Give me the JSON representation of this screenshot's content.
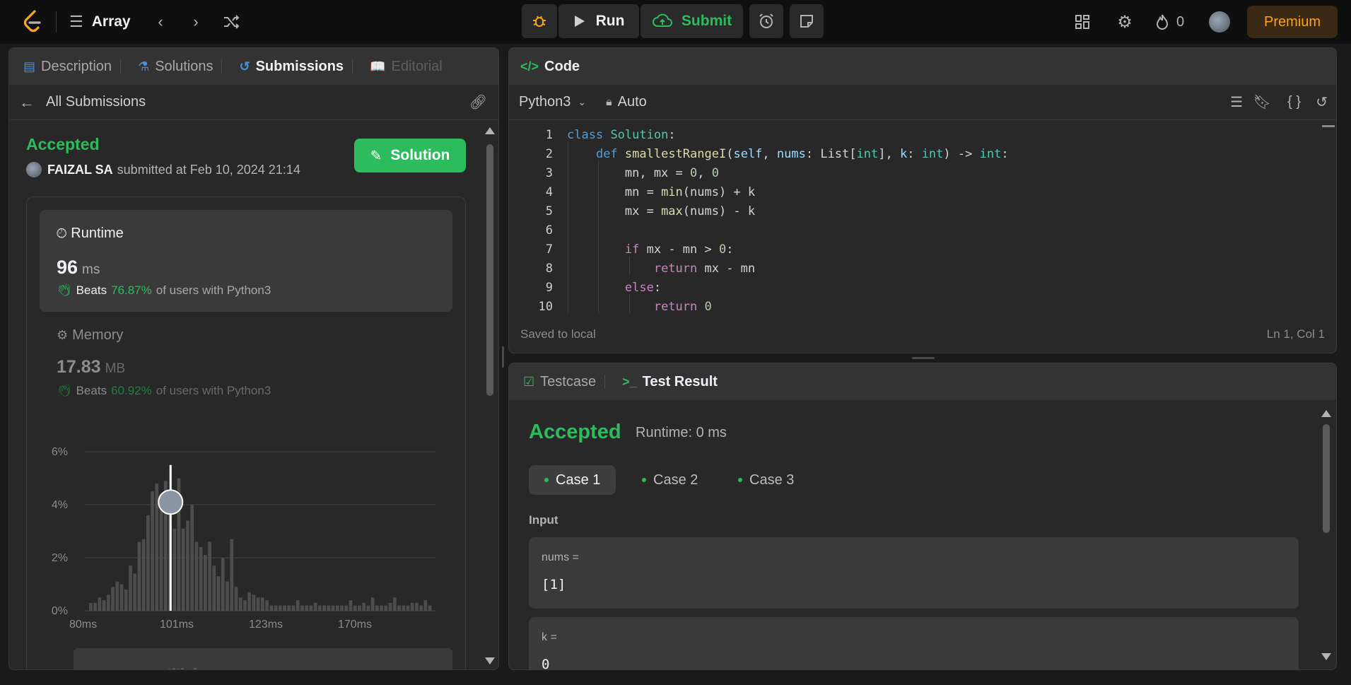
{
  "topbar": {
    "problem_list_label": "Array",
    "run_label": "Run",
    "submit_label": "Submit",
    "streak_count": "0",
    "premium_label": "Premium"
  },
  "left_panel": {
    "tabs": [
      {
        "label": "Description"
      },
      {
        "label": "Solutions"
      },
      {
        "label": "Submissions"
      },
      {
        "label": "Editorial"
      }
    ],
    "all_submissions_label": "All Submissions",
    "status": "Accepted",
    "user_name": "FAIZAL SA",
    "submitted_text": "submitted at Feb 10, 2024 21:14",
    "solution_button": "Solution",
    "runtime": {
      "title": "Runtime",
      "value": "96",
      "unit": "ms",
      "beats_label": "Beats",
      "beats_pct": "76.87%",
      "beats_suffix": "of users with Python3"
    },
    "memory": {
      "title": "Memory",
      "value": "17.83",
      "unit": "MB",
      "beats_label": "Beats",
      "beats_pct": "60.92%",
      "beats_suffix": "of users with Python3"
    }
  },
  "chart_data": {
    "type": "bar",
    "title": "",
    "xlabel": "",
    "ylabel": "",
    "ylim": [
      0,
      6
    ],
    "y_ticks": [
      "6%",
      "4%",
      "2%",
      "0%"
    ],
    "x_ticks": [
      "80ms",
      "101ms",
      "123ms",
      "170ms"
    ],
    "values": [
      0.3,
      0.3,
      0.5,
      0.4,
      0.6,
      0.9,
      1.1,
      1.0,
      0.8,
      1.7,
      1.4,
      2.6,
      2.7,
      3.6,
      4.5,
      4.8,
      4.4,
      4.9,
      4.0,
      3.1,
      5.0,
      3.1,
      3.4,
      4.0,
      2.6,
      2.4,
      2.1,
      2.6,
      1.7,
      1.3,
      2.0,
      1.1,
      2.7,
      0.9,
      0.5,
      0.4,
      0.7,
      0.6,
      0.5,
      0.5,
      0.4,
      0.2,
      0.2,
      0.2,
      0.2,
      0.2,
      0.2,
      0.4,
      0.2,
      0.2,
      0.2,
      0.3,
      0.2,
      0.2,
      0.2,
      0.2,
      0.2,
      0.2,
      0.2,
      0.4,
      0.2,
      0.2,
      0.3,
      0.2,
      0.5,
      0.2,
      0.2,
      0.2,
      0.3,
      0.5,
      0.2,
      0.2,
      0.2,
      0.3,
      0.3,
      0.2,
      0.4,
      0.2
    ],
    "highlight_index": 18,
    "highlight_value_ms": 96,
    "grid": true
  },
  "code_panel": {
    "title": "Code",
    "language": "Python3",
    "mode": "Auto",
    "saved_status": "Saved to local",
    "cursor_pos": "Ln 1, Col 1",
    "line_numbers": [
      "1",
      "2",
      "3",
      "4",
      "5",
      "6",
      "7",
      "8",
      "9",
      "10"
    ]
  },
  "result_panel": {
    "tabs": [
      {
        "label": "Testcase"
      },
      {
        "label": "Test Result"
      }
    ],
    "status": "Accepted",
    "runtime_text": "Runtime: 0 ms",
    "cases": [
      {
        "label": "Case 1"
      },
      {
        "label": "Case 2"
      },
      {
        "label": "Case 3"
      }
    ],
    "input_label": "Input",
    "inputs": [
      {
        "name": "nums =",
        "value": "[1]"
      },
      {
        "name": "k =",
        "value": "0"
      }
    ]
  }
}
